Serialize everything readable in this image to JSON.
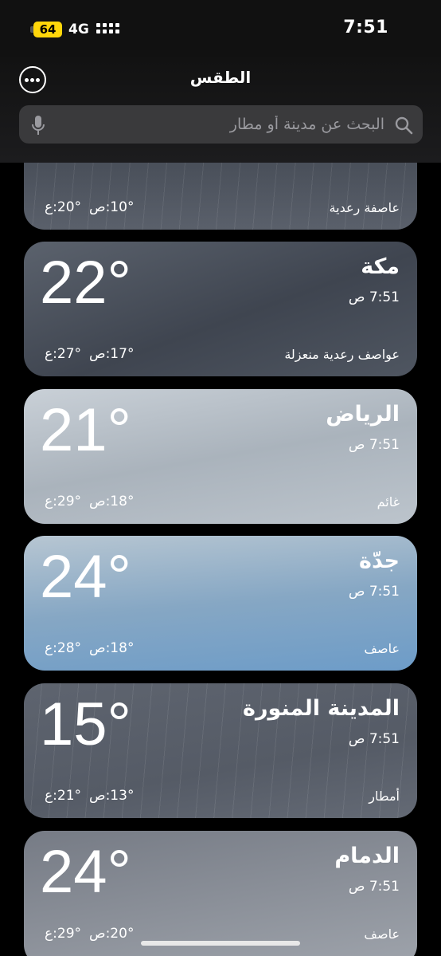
{
  "status": {
    "battery": "64",
    "network": "4G",
    "time": "7:51"
  },
  "header": {
    "title": "الطقس",
    "search_placeholder": "البحث عن مدينة أو مطار"
  },
  "icons": [
    "ellipsis-circle-icon",
    "search-icon",
    "microphone-icon",
    "signal-icon",
    "battery-icon"
  ],
  "cards": [
    {
      "city": "",
      "temp": "",
      "time": "",
      "condition": "عاصفة رعدية",
      "high": "ع:‎20°",
      "low": "ص:‎10°"
    },
    {
      "city": "مكة",
      "temp": "22°",
      "time": "7:51 ص",
      "condition": "عواصف رعدية منعزلة",
      "high": "ع:‎27°",
      "low": "ص:‎17°"
    },
    {
      "city": "الرياض",
      "temp": "21°",
      "time": "7:51 ص",
      "condition": "غائم",
      "high": "ع:‎29°",
      "low": "ص:‎18°"
    },
    {
      "city": "جدّة",
      "temp": "24°",
      "time": "7:51 ص",
      "condition": "عاصف",
      "high": "ع:‎28°",
      "low": "ص:‎18°"
    },
    {
      "city": "المدينة المنورة",
      "temp": "15°",
      "time": "7:51 ص",
      "condition": "أمطار",
      "high": "ع:‎21°",
      "low": "ص:‎13°"
    },
    {
      "city": "الدمام",
      "temp": "24°",
      "time": "7:51 ص",
      "condition": "عاصف",
      "high": "ع:‎29°",
      "low": "ص:‎20°"
    }
  ],
  "colors": {
    "storm": "#4d5460",
    "cloudy": "#b9c2ca",
    "windy": "#8fb2cf",
    "rain": "#5c626d",
    "accent_battery": "#ffd60a"
  }
}
